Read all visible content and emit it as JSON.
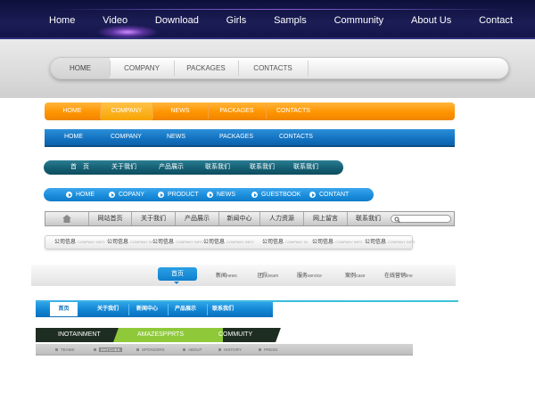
{
  "bar1": {
    "items": [
      "Home",
      "Video",
      "Download",
      "Girls",
      "Sampls",
      "Community",
      "About Us",
      "Contact"
    ]
  },
  "bar2": {
    "items": [
      "HOME",
      "COMPANY",
      "PACKAGES",
      "CONTACTS"
    ]
  },
  "bar3": {
    "items": [
      "HOME",
      "COMPANY",
      "NEWS",
      "PACKAGES",
      "CONTACTS"
    ],
    "accent": "#ff9400"
  },
  "bar4": {
    "items": [
      "HOME",
      "COMPANY",
      "NEWS",
      "PACKAGES",
      "CONTACTS"
    ],
    "accent": "#1474c2"
  },
  "bar5": {
    "items": [
      "首　页",
      "关于我们",
      "产品展示",
      "联系我们",
      "联系我们",
      "联系我们"
    ],
    "accent": "#155f73"
  },
  "bar6": {
    "items": [
      "HOME",
      "COPANY",
      "PRODUCT",
      "NEWS",
      "GUESTBOOK",
      "CONTANT"
    ],
    "accent": "#1b8ddb"
  },
  "bar7": {
    "items": [
      "网站首页",
      "关于我们",
      "产品展示",
      "新闻中心",
      "人力资源",
      "网上留言",
      "联系我们"
    ],
    "icons": [
      "home-icon",
      "search-icon"
    ]
  },
  "bar8": {
    "items": [
      {
        "cn": "公司信息",
        "en": "COMPANY INFO"
      },
      {
        "cn": "公司信息",
        "en": "COMPANY IN"
      },
      {
        "cn": "公司信息",
        "en": "COMPANY INFO"
      },
      {
        "cn": "公司信息",
        "en": "COMPANY INFO"
      },
      {
        "cn": "公司信息",
        "en": "COMPANY IN"
      },
      {
        "cn": "公司信息",
        "en": "COMPANY INFO"
      },
      {
        "cn": "公司信息",
        "en": "COMPANY INFO"
      }
    ]
  },
  "bar9": {
    "active": "首页",
    "items": [
      {
        "cn": "新闻",
        "en": "news"
      },
      {
        "cn": "团队",
        "en": "team"
      },
      {
        "cn": "服务",
        "en": "service"
      },
      {
        "cn": "案例",
        "en": "case"
      },
      {
        "cn": "在线营销",
        "en": "line"
      }
    ]
  },
  "bar10": {
    "home": "首页",
    "items": [
      "关于我们",
      "新闻中心",
      "产品展示",
      "联系我们"
    ],
    "accent": "#1184d2"
  },
  "bar11": {
    "items": [
      "INOTAINMENT",
      "AMAZESPPRTS",
      "COMMUITY"
    ],
    "colors": {
      "dark": "#1e2d21",
      "green": "#8fc93a"
    }
  },
  "bar12": {
    "items": [
      "TEAMS",
      "MATCHES",
      "SPONSORS",
      "ABOUT",
      "HISTORY",
      "PRESS"
    ],
    "active": "MATCHES"
  }
}
